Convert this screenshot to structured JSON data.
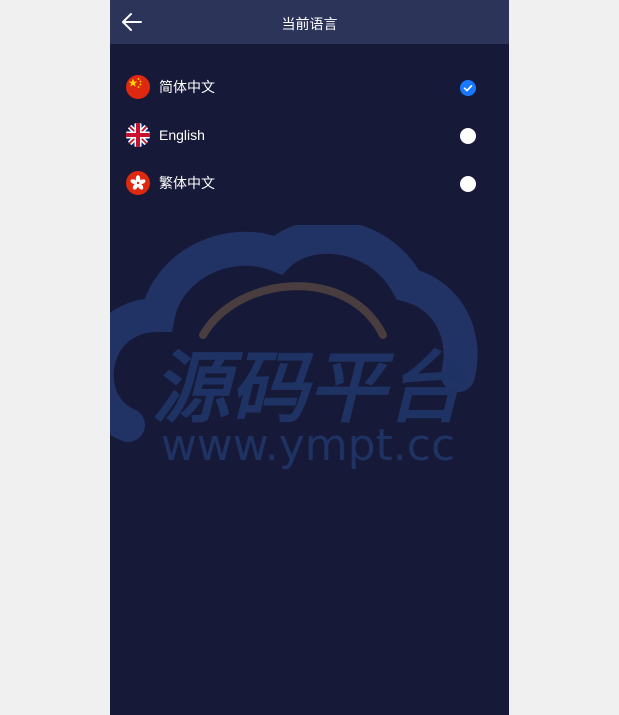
{
  "header": {
    "title": "当前语言",
    "back_icon": "arrow-left-icon"
  },
  "languages": [
    {
      "label": "简体中文",
      "flag": "china-flag-icon",
      "selected": true
    },
    {
      "label": "English",
      "flag": "uk-flag-icon",
      "selected": false
    },
    {
      "label": "繁体中文",
      "flag": "hong-kong-flag-icon",
      "selected": false
    }
  ],
  "watermark": {
    "brand": "源码平台",
    "url": "www.ympt.cc"
  },
  "colors": {
    "background": "#161a38",
    "header": "#2c3459",
    "accent": "#1779ff"
  }
}
